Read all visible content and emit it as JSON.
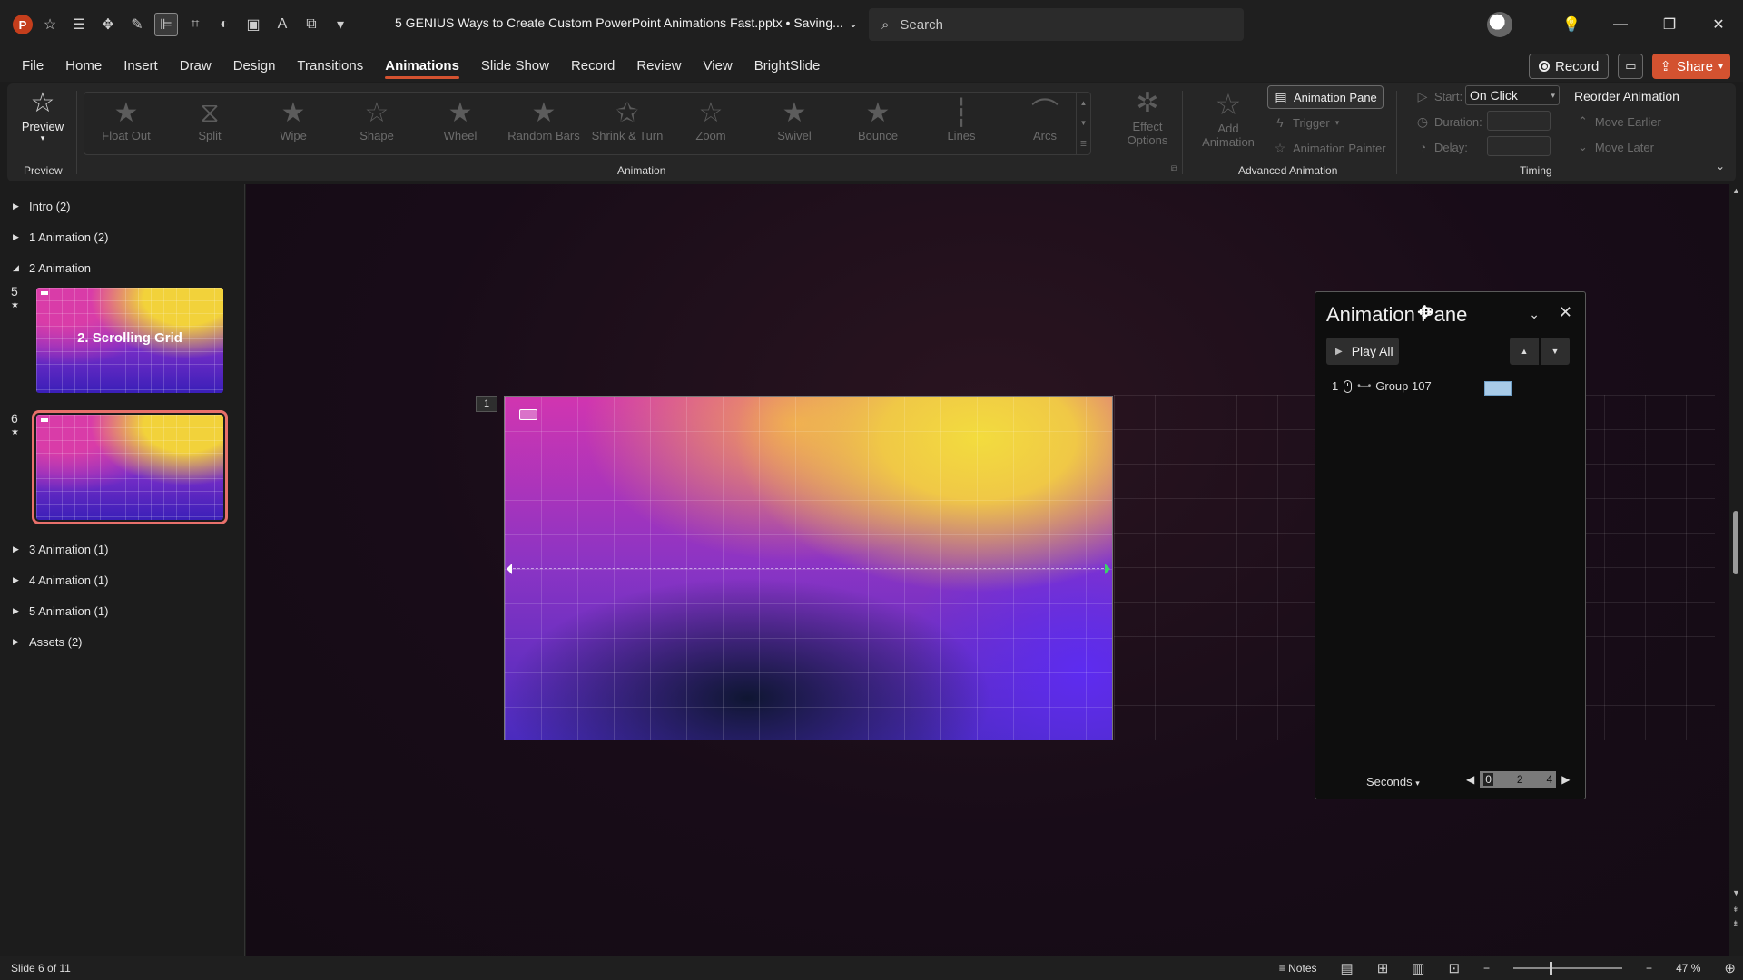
{
  "app": {
    "doc_title": "5 GENIUS Ways to Create Custom PowerPoint Animations Fast.pptx • Saving...",
    "search_placeholder": "Search"
  },
  "menu": {
    "tabs": [
      "File",
      "Home",
      "Insert",
      "Draw",
      "Design",
      "Transitions",
      "Animations",
      "Slide Show",
      "Record",
      "Review",
      "View",
      "BrightSlide"
    ],
    "active_tab": "Animations",
    "record_label": "Record",
    "share_label": "Share"
  },
  "ribbon": {
    "preview_label": "Preview",
    "preview_group": "Preview",
    "animation_group": "Animation",
    "gallery": [
      "Float Out",
      "Split",
      "Wipe",
      "Shape",
      "Wheel",
      "Random Bars",
      "Shrink & Turn",
      "Zoom",
      "Swivel",
      "Bounce",
      "Lines",
      "Arcs"
    ],
    "effect_options": "Effect Options",
    "add_animation": "Add Animation",
    "animation_pane": "Animation Pane",
    "trigger": "Trigger",
    "animation_painter": "Animation Painter",
    "advanced_group": "Advanced Animation",
    "start_label": "Start:",
    "start_value": "On Click",
    "duration_label": "Duration:",
    "delay_label": "Delay:",
    "timing_group": "Timing",
    "reorder_title": "Reorder Animation",
    "move_earlier": "Move Earlier",
    "move_later": "Move Later"
  },
  "slides_panel": {
    "sections": [
      {
        "label": "Intro (2)",
        "expanded": false
      },
      {
        "label": "1 Animation (2)",
        "expanded": false
      },
      {
        "label": "2 Animation",
        "expanded": true
      },
      {
        "label": "3 Animation (1)",
        "expanded": false
      },
      {
        "label": "4 Animation (1)",
        "expanded": false
      },
      {
        "label": "5 Animation (1)",
        "expanded": false
      },
      {
        "label": "Assets (2)",
        "expanded": false
      }
    ],
    "thumbnails": [
      {
        "number": "5",
        "title": "2. Scrolling Grid",
        "selected": false
      },
      {
        "number": "6",
        "title": "",
        "selected": true
      }
    ]
  },
  "canvas": {
    "animation_badge": "1"
  },
  "animation_pane": {
    "title": "Animation Pane",
    "play_all": "Play All",
    "items": [
      {
        "index": "1",
        "name": "Group 107"
      }
    ],
    "units": "Seconds",
    "scale": [
      "0",
      "2",
      "4"
    ]
  },
  "status": {
    "slide_info": "Slide 6 of 11",
    "notes": "Notes",
    "zoom": "47 %"
  }
}
